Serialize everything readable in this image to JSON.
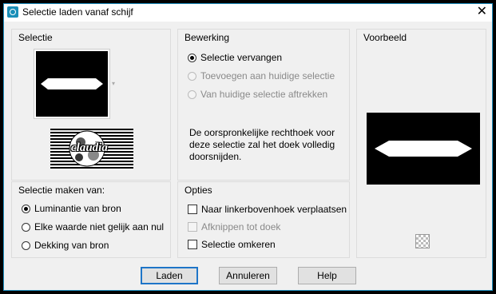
{
  "window": {
    "title": "Selectie laden vanaf schijf",
    "close_glyph": "✕"
  },
  "selectie": {
    "label": "Selectie",
    "thumb_caption": "claudia"
  },
  "bewerking": {
    "label": "Bewerking",
    "options": [
      {
        "label": "Selectie vervangen",
        "selected": true,
        "enabled": true
      },
      {
        "label": "Toevoegen aan huidige selectie",
        "selected": false,
        "enabled": false
      },
      {
        "label": "Van huidige selectie aftrekken",
        "selected": false,
        "enabled": false
      }
    ],
    "note": "De oorspronkelijke rechthoek voor deze selectie zal het doek volledig doorsnijden."
  },
  "voorbeeld": {
    "label": "Voorbeeld"
  },
  "maken": {
    "label": "Selectie maken van:",
    "options": [
      {
        "label": "Luminantie van bron",
        "selected": true
      },
      {
        "label": "Elke waarde niet gelijk aan nul",
        "selected": false
      },
      {
        "label": "Dekking van bron",
        "selected": false
      }
    ]
  },
  "opties": {
    "label": "Opties",
    "items": [
      {
        "label": "Naar linkerbovenhoek verplaatsen",
        "checked": false,
        "enabled": true
      },
      {
        "label": "Afknippen tot doek",
        "checked": false,
        "enabled": false
      },
      {
        "label": "Selectie omkeren",
        "checked": false,
        "enabled": true
      }
    ]
  },
  "buttons": {
    "load": "Laden",
    "cancel": "Annuleren",
    "help": "Help"
  },
  "colors": {
    "accent": "#1e75c8",
    "title_icon": "#1a8fb8"
  },
  "icons": {
    "app": "app-icon",
    "close": "close-icon",
    "transparency": "checkerboard-icon"
  }
}
